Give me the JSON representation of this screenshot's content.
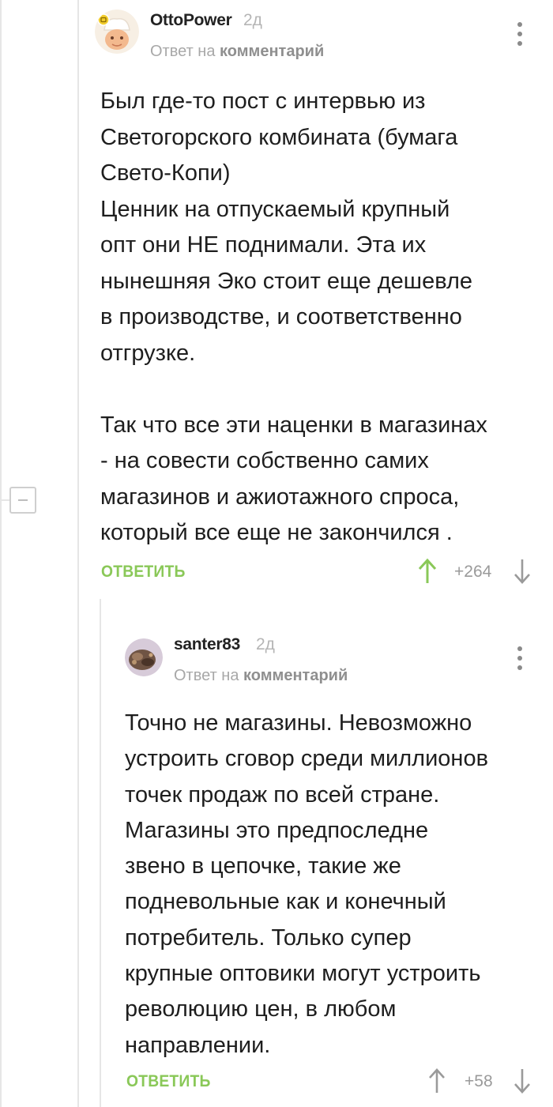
{
  "colors": {
    "accent_green": "#8ac858",
    "muted_gray": "#9a9a9a",
    "text": "#1e1e1e"
  },
  "comments": [
    {
      "author": "OttoPower",
      "time": "2д",
      "reply_prefix": "Ответ на",
      "reply_link": "комментарий",
      "body": "Был где-то пост с интервью из\nСветогорского комбината (бумага\nСвето-Копи)\nЦенник на отпускаемый крупный\nопт они НЕ поднимали. Эта их\nнынешняя Эко стоит еще дешевле\nв производстве, и соответственно\nотгрузке.\n\nТак что все эти наценки в магазинах\n- на совести собственно самих\nмагазинов и ажиотажного спроса,\nкоторый все еще не закончился .",
      "reply_label": "ОТВЕТИТЬ",
      "score": "+264",
      "upvoted": true,
      "avatar_icon": "chef-avatar-icon"
    },
    {
      "author": "santer83",
      "time": "2д",
      "reply_prefix": "Ответ на",
      "reply_link": "комментарий",
      "body": "Точно не магазины. Невозможно\nустроить сговор среди миллионов\nточек продаж по всей стране.\nМагазины это предпоследне\nзвено в  цепочке, такие же\nподневольные как и конечный\nпотребитель. Только супер\nкрупные оптовики могут устроить\nреволюцию цен, в любом\nнаправлении.",
      "reply_label": "ОТВЕТИТЬ",
      "score": "+58",
      "upvoted": false,
      "avatar_icon": "photo-avatar-icon"
    }
  ]
}
